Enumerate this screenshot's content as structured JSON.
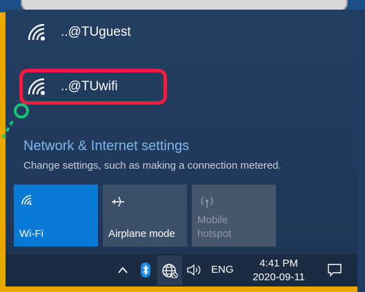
{
  "networks": [
    {
      "name": "..@TUguest",
      "icon": "wifi-signal-icon"
    },
    {
      "name": "..@TUwifi",
      "icon": "wifi-signal-icon"
    }
  ],
  "settings": {
    "title": "Network & Internet settings",
    "subtitle": "Change settings, such as making a connection metered."
  },
  "quick_actions": [
    {
      "label": "Wi-Fi",
      "icon": "wifi-icon",
      "state": "on"
    },
    {
      "label": "Airplane mode",
      "icon": "airplane-icon",
      "state": "off"
    },
    {
      "label": "Mobile hotspot",
      "icon": "hotspot-icon",
      "state": "disabled"
    }
  ],
  "taskbar": {
    "language": "ENG",
    "time": "4:41 PM",
    "date": "2020-09-11"
  },
  "colors": {
    "accent": "#0a79d6",
    "highlight": "#ff1a3c",
    "link": "#7fb7ea"
  }
}
